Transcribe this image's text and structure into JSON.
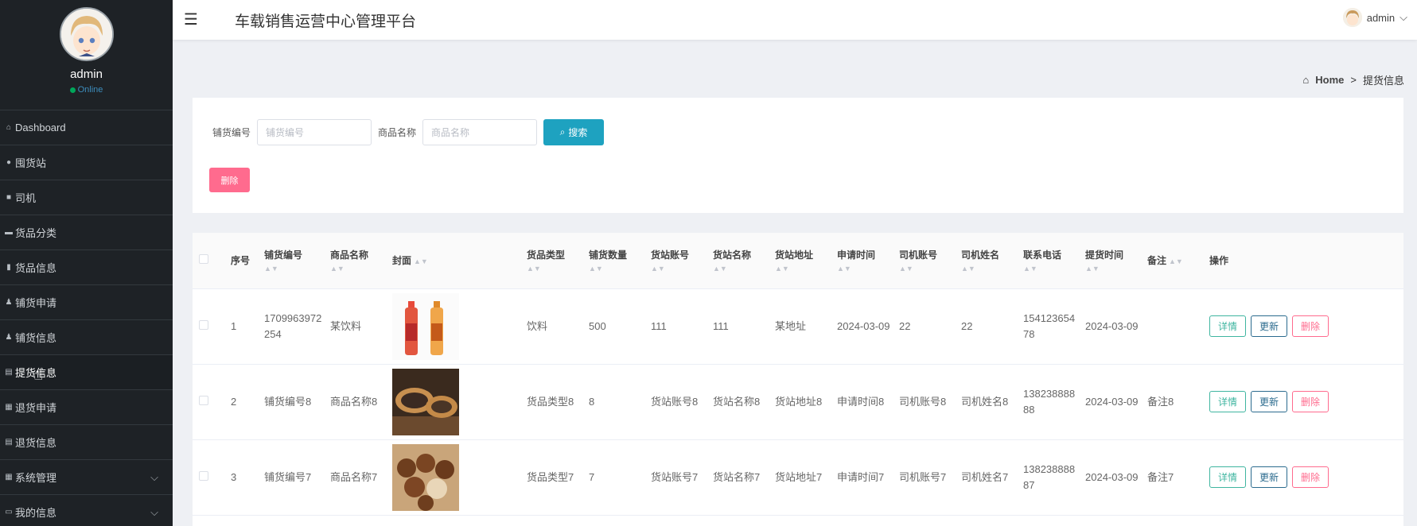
{
  "sidebar": {
    "username": "admin",
    "status": "Online",
    "items": [
      {
        "label": "Dashboard",
        "icon": "home-icon"
      },
      {
        "label": "囤货站",
        "icon": "map-pin-icon"
      },
      {
        "label": "司机",
        "icon": "chat-icon"
      },
      {
        "label": "货品分类",
        "icon": "box-icon"
      },
      {
        "label": "货品信息",
        "icon": "books-icon"
      },
      {
        "label": "铺货申请",
        "icon": "user-icon"
      },
      {
        "label": "铺货信息",
        "icon": "user-icon"
      },
      {
        "label": "提货信息",
        "icon": "clipboard-icon"
      },
      {
        "label": "退货申请",
        "icon": "grid-icon"
      },
      {
        "label": "退货信息",
        "icon": "file-icon"
      },
      {
        "label": "系统管理",
        "icon": "grid-icon"
      },
      {
        "label": "我的信息",
        "icon": "window-icon"
      }
    ]
  },
  "header": {
    "title": "车载销售运营中心管理平台",
    "user": "admin"
  },
  "breadcrumb": {
    "home": "Home",
    "separator": ">",
    "current": "提货信息"
  },
  "search": {
    "field1_label": "铺货编号",
    "field1_placeholder": "铺货编号",
    "field2_label": "商品名称",
    "field2_placeholder": "商品名称",
    "search_button": "搜索",
    "delete_button": "删除"
  },
  "table": {
    "columns": [
      "序号",
      "铺货编号",
      "商品名称",
      "封面",
      "货品类型",
      "铺货数量",
      "货站账号",
      "货站名称",
      "货站地址",
      "申请时间",
      "司机账号",
      "司机姓名",
      "联系电话",
      "提货时间",
      "备注",
      "操作"
    ],
    "action_labels": {
      "detail": "详情",
      "update": "更新",
      "delete": "删除"
    },
    "rows": [
      {
        "idx": "1",
        "code": "1709963972254",
        "name": "某饮料",
        "image": "bottles",
        "type": "饮料",
        "qty": "500",
        "station_acct": "111",
        "station_name": "111",
        "station_addr": "某地址",
        "apply_time": "2024-03-09",
        "driver_acct": "22",
        "driver_name": "22",
        "phone": "15412365478",
        "pickup_time": "2024-03-09",
        "note": ""
      },
      {
        "idx": "2",
        "code": "铺货编号8",
        "name": "商品名称8",
        "image": "mooncakes",
        "type": "货品类型8",
        "qty": "8",
        "station_acct": "货站账号8",
        "station_name": "货站名称8",
        "station_addr": "货站地址8",
        "apply_time": "申请时间8",
        "driver_acct": "司机账号8",
        "driver_name": "司机姓名8",
        "phone": "13823888888",
        "pickup_time": "2024-03-09",
        "note": "备注8"
      },
      {
        "idx": "3",
        "code": "铺货编号7",
        "name": "商品名称7",
        "image": "nuts",
        "type": "货品类型7",
        "qty": "7",
        "station_acct": "货站账号7",
        "station_name": "货站名称7",
        "station_addr": "货站地址7",
        "apply_time": "申请时间7",
        "driver_acct": "司机账号7",
        "driver_name": "司机姓名7",
        "phone": "13823888887",
        "pickup_time": "2024-03-09",
        "note": "备注7"
      }
    ]
  }
}
